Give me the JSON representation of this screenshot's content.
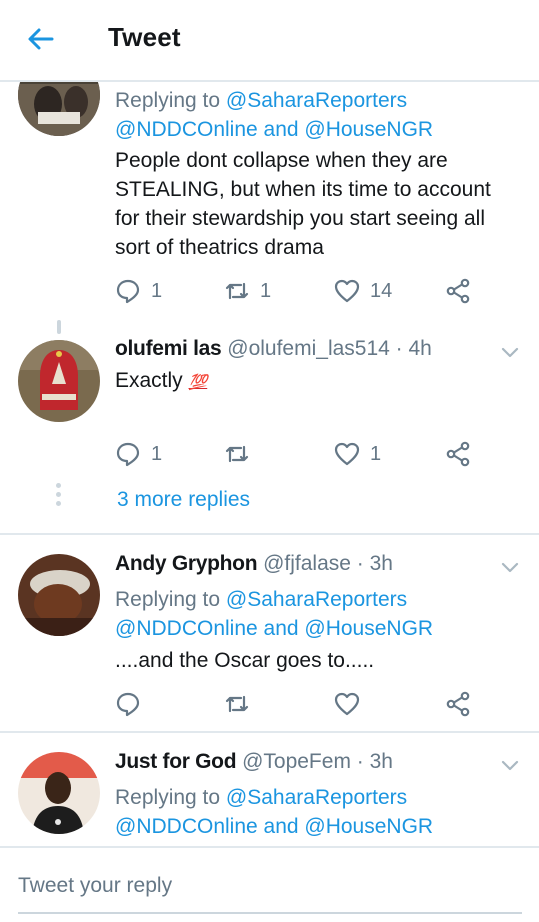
{
  "header": {
    "title": "Tweet"
  },
  "tweets": [
    {
      "reply_to_prefix": "Replying to ",
      "reply_to_line1": "@SaharaReporters",
      "reply_to_line2": "@NDDCOnline and @HouseNGR",
      "text_lines": [
        "People dont collapse when they are",
        "STEALING, but when its time to account",
        "for their stewardship  you start seeing all",
        "sort of theatrics drama"
      ],
      "replies": "1",
      "retweets": "1",
      "likes": "14"
    },
    {
      "name": "olufemi las",
      "handle": "@olufemi_las514 · 4h",
      "text": "Exactly ",
      "emoji": "💯",
      "replies": "1",
      "retweets": "",
      "likes": "1"
    },
    {
      "name": "Andy Gryphon",
      "handle": "@fjfalase · 3h",
      "reply_to_prefix": "Replying to ",
      "reply_to_line1": "@SaharaReporters",
      "reply_to_line2": "@NDDCOnline and @HouseNGR",
      "text": "....and the Oscar goes to.....",
      "replies": "",
      "retweets": "",
      "likes": ""
    },
    {
      "name": "Just for God",
      "handle": "@TopeFem · 3h",
      "reply_to_prefix": "Replying to ",
      "reply_to_line1": "@SaharaReporters",
      "reply_to_line2": "@NDDCOnline and @HouseNGR"
    }
  ],
  "more_replies": "3 more replies",
  "compose": {
    "placeholder": "Tweet your reply"
  },
  "colors": {
    "accent": "#1b95e0",
    "secondary": "#657786",
    "divider": "#e1e8ed"
  }
}
